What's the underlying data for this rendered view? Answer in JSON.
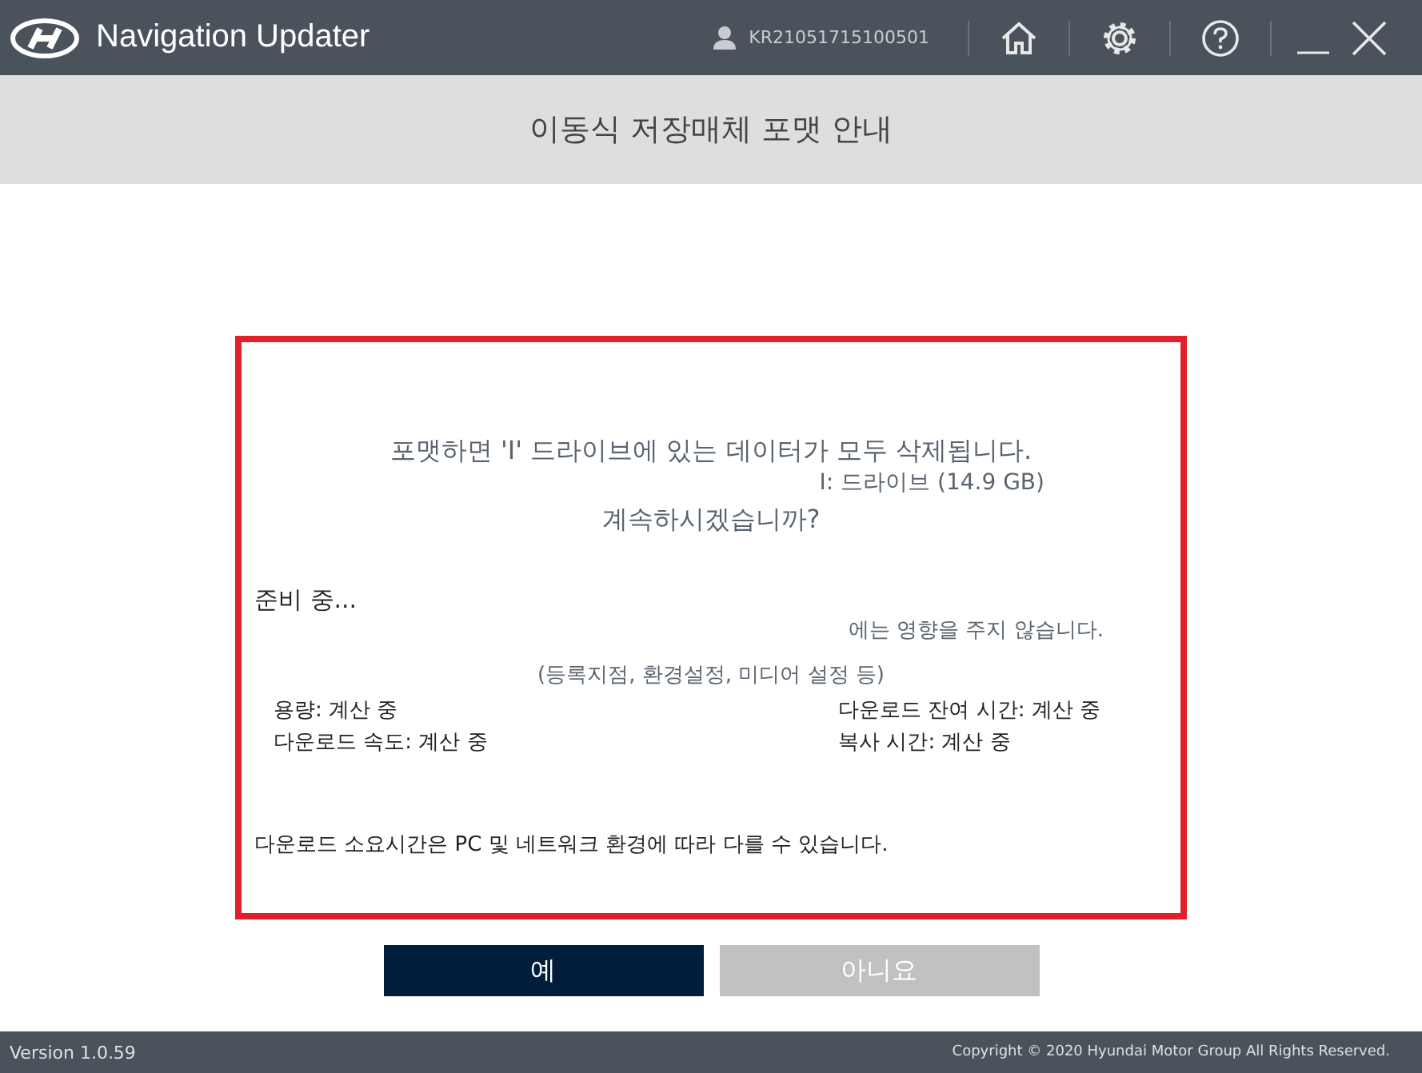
{
  "window": {
    "title": "Navigation Updater",
    "user_id": "KR21051715100501"
  },
  "page_title": "이동식 저장매체 포맷 안내",
  "confirm": {
    "question": "포맷하면 'I' 드라이브에 있는 데이터가 모두 삭제됩니다.",
    "drive": "I: 드라이브 (14.9 GB)",
    "prompt": "계속하시겠습니까?",
    "note": "에는 영향을 주지 않습니다.",
    "buttons": [
      {
        "label": "예",
        "kind": "primary"
      },
      {
        "label": "아니요",
        "kind": "secondary"
      }
    ]
  },
  "progress": {
    "status": "준비 중...",
    "detail": "(등록지점, 환경설정, 미디어 설정 등)",
    "stats_left": [
      "용량: 계산 중",
      "다운로드 속도: 계산 중"
    ],
    "stats_right": [
      "다운로드 잔여 시간: 계산 중",
      "복사 시간: 계산 중"
    ],
    "footnote": "다운로드 소요시간은 PC 및 네트워크 환경에 따라 다를 수 있습니다."
  },
  "status_bar": {
    "version": "Version 1.0.59",
    "copyright": "Copyright © 2020 Hyundai Motor Group All Rights Reserved."
  }
}
